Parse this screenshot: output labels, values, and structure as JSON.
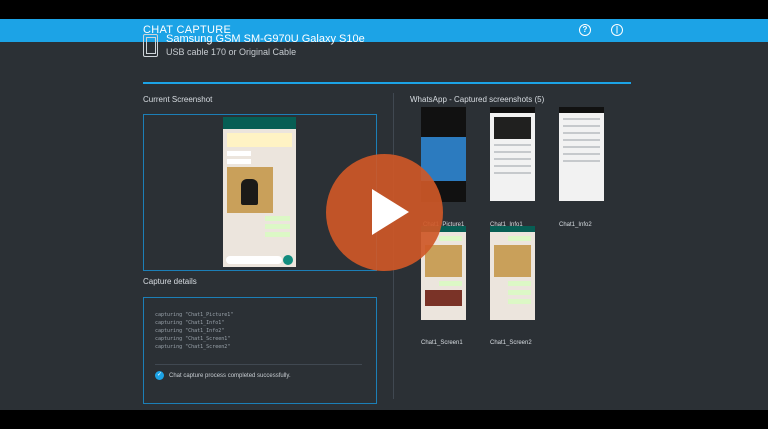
{
  "app": {
    "title": "CHAT CAPTURE",
    "help_icon": "help-icon",
    "power_icon": "power-icon"
  },
  "device": {
    "name": "Samsung GSM SM-G970U Galaxy S10e",
    "connection": "USB cable 170 or Original Cable"
  },
  "current": {
    "heading": "Current Screenshot"
  },
  "details": {
    "heading": "Capture details",
    "log": [
      "capturing \"Chat1_Picture1\"",
      "capturing \"Chat1_Info1\"",
      "capturing \"Chat1_Info2\"",
      "capturing \"Chat1_Screen1\"",
      "capturing \"Chat1_Screen2\""
    ],
    "status": "Chat capture process completed successfully."
  },
  "gallery": {
    "heading": "WhatsApp - Captured screenshots (5)",
    "items": [
      {
        "label": "Chat1_Picture1"
      },
      {
        "label": "Chat1_Info1"
      },
      {
        "label": "Chat1_Info2"
      },
      {
        "label": "Chat1_Screen1"
      },
      {
        "label": "Chat1_Screen2"
      }
    ]
  },
  "player": {
    "play_icon": "play-icon",
    "accent": "#ce5827"
  }
}
